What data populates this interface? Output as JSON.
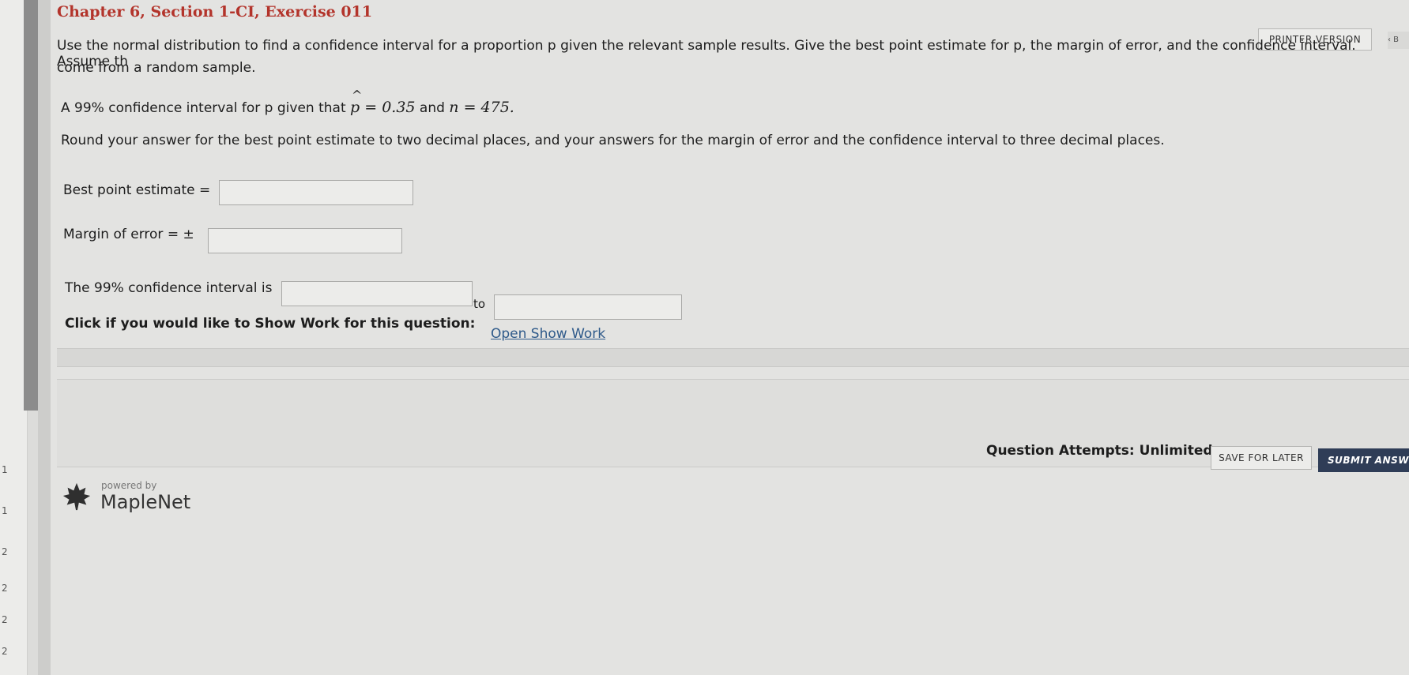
{
  "header": {
    "title": "Chapter 6, Section 1-CI, Exercise 011",
    "printer_version": "PRINTER VERSION",
    "edge_label": "‹ B"
  },
  "question": {
    "instructions_line1": "Use the normal distribution to find a confidence interval for a proportion p given the relevant sample results. Give the best point estimate for p, the margin of error, and the confidence interval. Assume th",
    "instructions_line2": "come from a random sample.",
    "prompt_prefix": "A 99% confidence interval for p given that",
    "p_hat": "p = 0.35",
    "and": "and",
    "n_value": "n = 475.",
    "rounding": "Round your answer for the best point estimate to two decimal places, and your answers for the margin of error and the confidence interval to three decimal places."
  },
  "answers": {
    "best_point_label": "Best point estimate =",
    "best_point_value": "",
    "margin_label": "Margin of error = ±",
    "margin_value": "",
    "interval_label": "The 99% confidence interval is",
    "interval_lower": "",
    "interval_to": "to",
    "interval_upper": ""
  },
  "show_work": {
    "label": "Click if you would like to Show Work for this question:",
    "link": "Open Show Work"
  },
  "footer": {
    "attempts": "Question Attempts: Unlimited",
    "save_label": "SAVE FOR LATER",
    "submit_label": "SUBMIT ANSW",
    "powered_by": "powered by",
    "brand": "MapleNet"
  },
  "left_margin_ticks": [
    "1",
    "1",
    "2",
    "2",
    "2",
    "2"
  ],
  "colors": {
    "title": "#b3342b",
    "link": "#2f5a8a",
    "submit_bg": "#2f3d57"
  }
}
